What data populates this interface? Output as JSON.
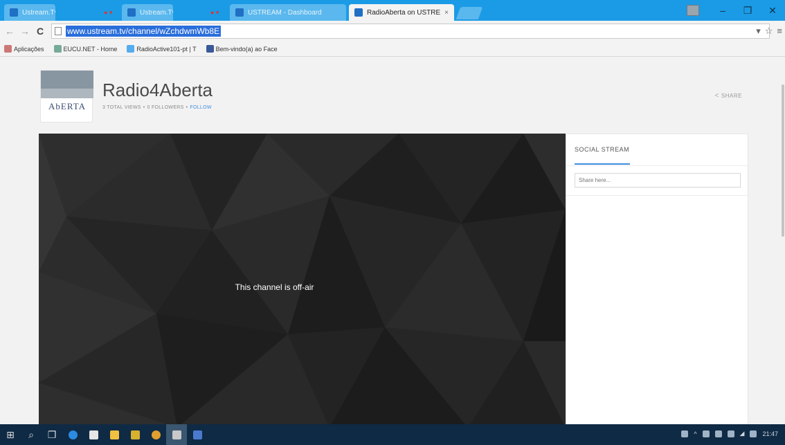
{
  "tabs": [
    {
      "label": "Ustream.Tv",
      "has_dots": true
    },
    {
      "label": "Ustream.Tv",
      "has_dots": true
    },
    {
      "label": "USTREAM - Dashboard",
      "has_dots": false
    },
    {
      "label": "RadioAberta on USTRE",
      "has_dots": false
    }
  ],
  "toolbar": {
    "url": "www.ustream.tv/channel/wZchdwmWb8E"
  },
  "bookmarks": [
    {
      "label": "Aplicações",
      "icon": "apps-icon"
    },
    {
      "label": "EUCU.NET - Home",
      "icon": "eucu-icon"
    },
    {
      "label": "RadioActive101-pt | T",
      "icon": "twitter-icon"
    },
    {
      "label": "Bem-vindo(a) ao Face",
      "icon": "facebook-icon"
    }
  ],
  "channel": {
    "logo_text": "AbERTA",
    "title": "Radio4Aberta",
    "meta_views": "3 TOTAL VIEWS",
    "meta_sep": "•",
    "meta_followers": "0 FOLLOWERS",
    "meta_follow": "FOLLOW",
    "share": "SHARE"
  },
  "player": {
    "status": "This channel is off-air"
  },
  "social": {
    "title": "SOCIAL STREAM",
    "input_placeholder": "Share here..."
  },
  "taskbar": {
    "clock": "21:47"
  },
  "colors": {
    "chrome_blue": "#1b9be6",
    "accent": "#3d8ce0",
    "player_bg": "#262626"
  }
}
